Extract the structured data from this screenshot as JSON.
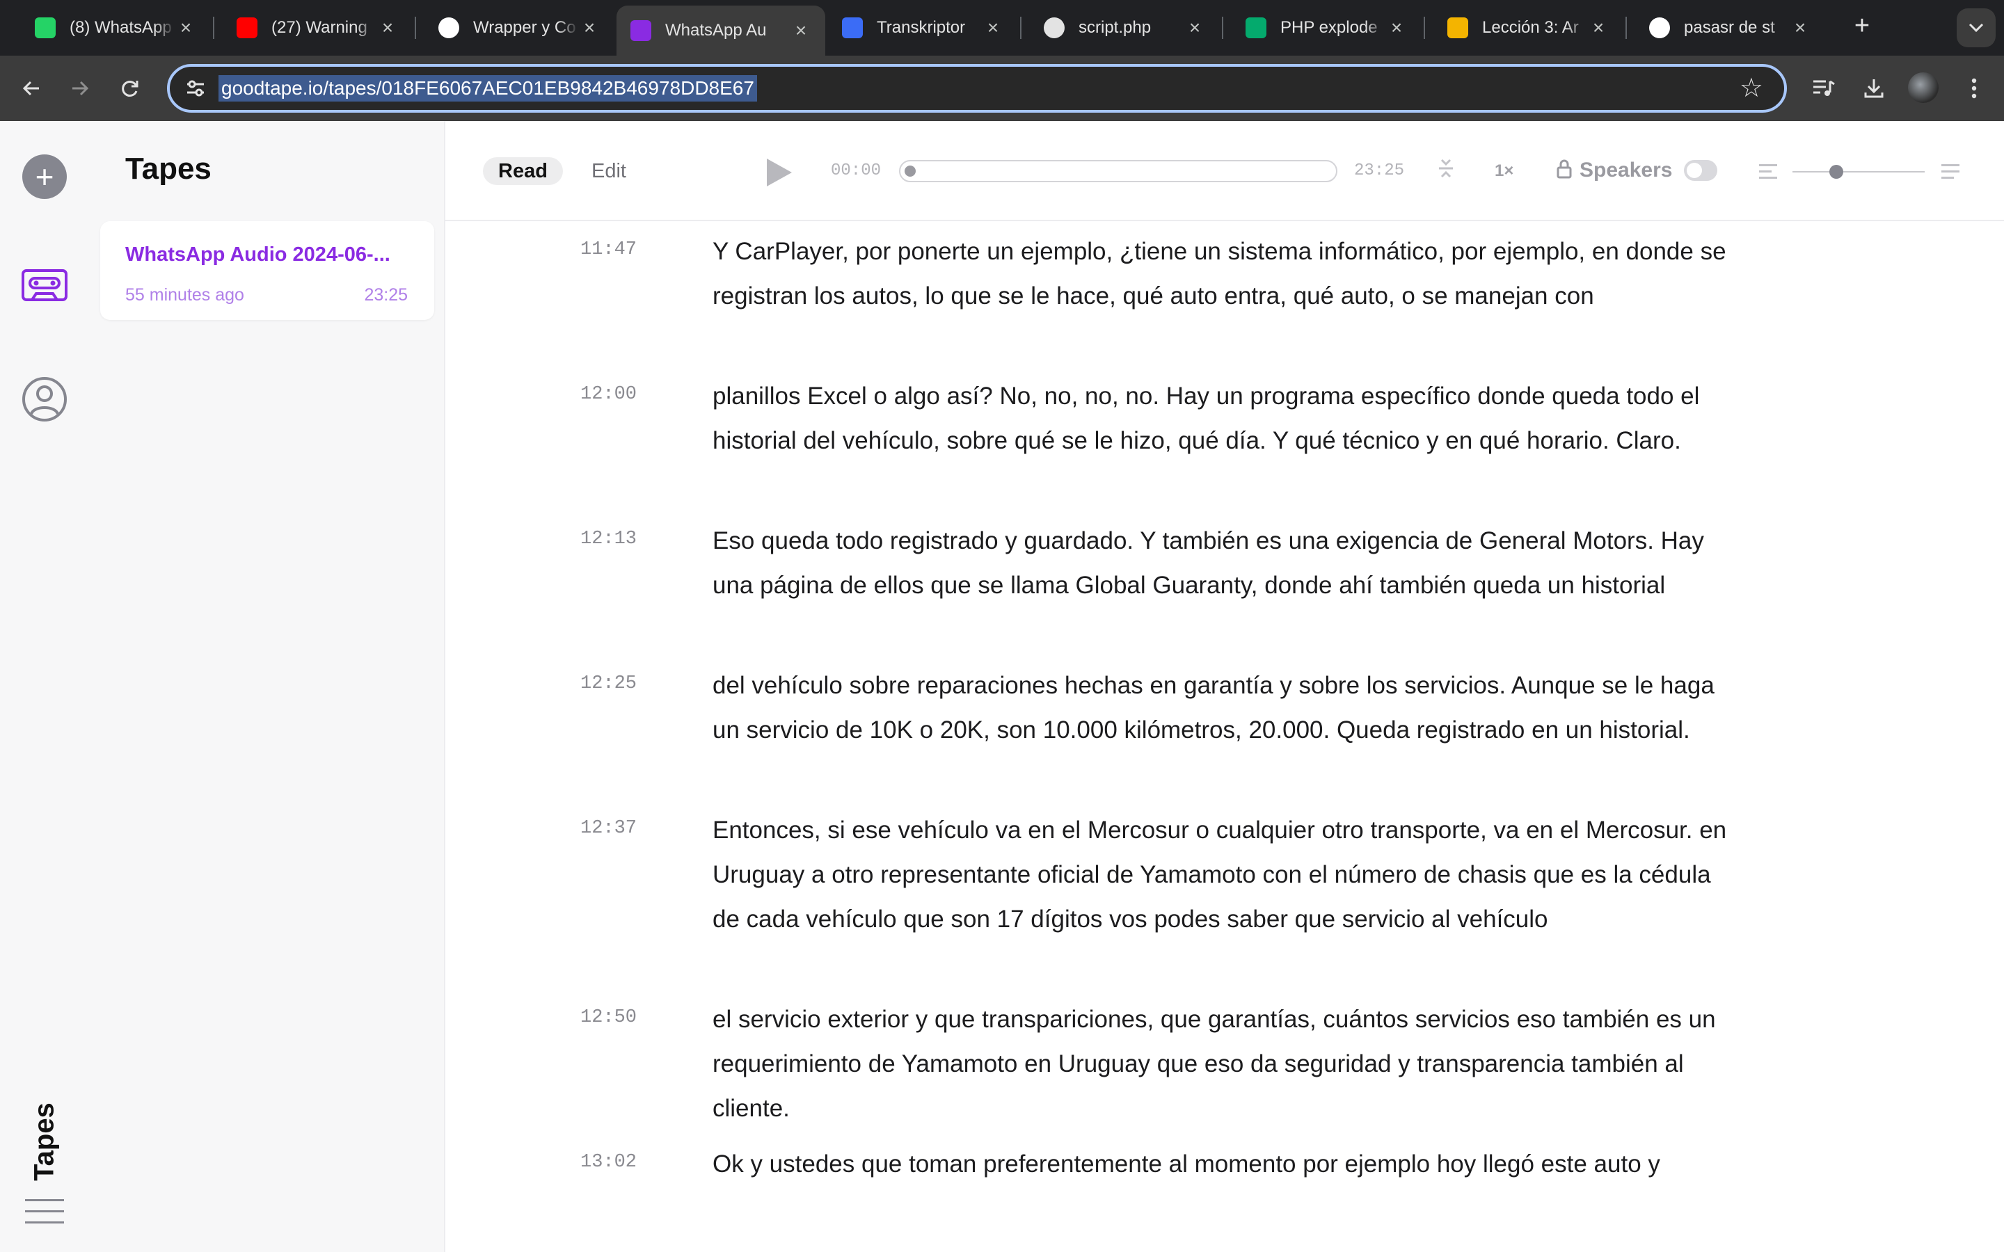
{
  "browser": {
    "tabs": [
      {
        "title": "(8) WhatsApp",
        "icon": "whatsapp-icon",
        "color": "#25d366",
        "active": false
      },
      {
        "title": "(27) Warning",
        "icon": "youtube-icon",
        "color": "#ff0000",
        "active": false
      },
      {
        "title": "Wrapper y Co",
        "icon": "chatgpt-icon",
        "color": "#ffffff",
        "active": false
      },
      {
        "title": "WhatsApp Au",
        "icon": "goodtape-icon",
        "color": "#8a2be2",
        "active": true
      },
      {
        "title": "Transkriptor",
        "icon": "transkriptor-icon",
        "color": "#3b6cf6",
        "active": false
      },
      {
        "title": "script.php",
        "icon": "github-icon",
        "color": "#e3e3e3",
        "active": false
      },
      {
        "title": "PHP explode",
        "icon": "w3schools-icon",
        "color": "#04aa6d",
        "active": false
      },
      {
        "title": "Lección 3: Ar",
        "icon": "code-icon",
        "color": "#f4b400",
        "active": false
      },
      {
        "title": "pasasr de st",
        "icon": "google-icon",
        "color": "#ffffff",
        "active": false
      }
    ],
    "url": "goodtape.io/tapes/018FE6067AEC01EB9842B46978DD8E67"
  },
  "rail": {
    "vertical_label": "Tapes"
  },
  "sidebar": {
    "title": "Tapes",
    "tapes": [
      {
        "title": "WhatsApp Audio 2024-06-...",
        "age": "55 minutes ago",
        "duration": "23:25"
      }
    ]
  },
  "player": {
    "modes": {
      "read": "Read",
      "edit": "Edit"
    },
    "current_time": "00:00",
    "duration": "23:25",
    "progress": 0,
    "speed": "1×",
    "speakers_label": "Speakers",
    "speakers_enabled": false,
    "text_size": 0.33
  },
  "transcript": [
    {
      "time": "11:47",
      "text": "Y CarPlayer, por ponerte un ejemplo, ¿tiene un sistema informático, por ejemplo, en donde se registran los autos, lo que se le hace, qué auto entra, qué auto, o se manejan con"
    },
    {
      "time": "12:00",
      "text": "planillos Excel o algo así? No, no, no, no. Hay un programa específico donde queda todo el historial del vehículo, sobre qué se le hizo, qué día. Y qué técnico y en qué horario. Claro."
    },
    {
      "time": "12:13",
      "text": "Eso queda todo registrado y guardado. Y también es una exigencia de General Motors. Hay una página de ellos que se llama Global Guaranty, donde ahí también queda un historial"
    },
    {
      "time": "12:25",
      "text": "del vehículo sobre reparaciones hechas en garantía y sobre los servicios. Aunque se le haga un servicio de 10K o 20K, son 10.000 kilómetros, 20.000. Queda registrado en un historial."
    },
    {
      "time": "12:37",
      "text": "Entonces, si ese vehículo va en el Mercosur o cualquier otro transporte, va en el Mercosur. en Uruguay a otro representante oficial de Yamamoto con el número de chasis que es la cédula de cada vehículo que son 17 dígitos vos podes saber que servicio al vehículo"
    },
    {
      "time": "12:50",
      "text": "el servicio exterior y que transpariciones, que garantías, cuántos servicios eso también es un requerimiento de Yamamoto en Uruguay que eso da seguridad y transparencia también al cliente."
    },
    {
      "time": "13:02",
      "text": "Ok y ustedes que toman preferentemente al momento por ejemplo hoy llegó este auto y"
    }
  ]
}
